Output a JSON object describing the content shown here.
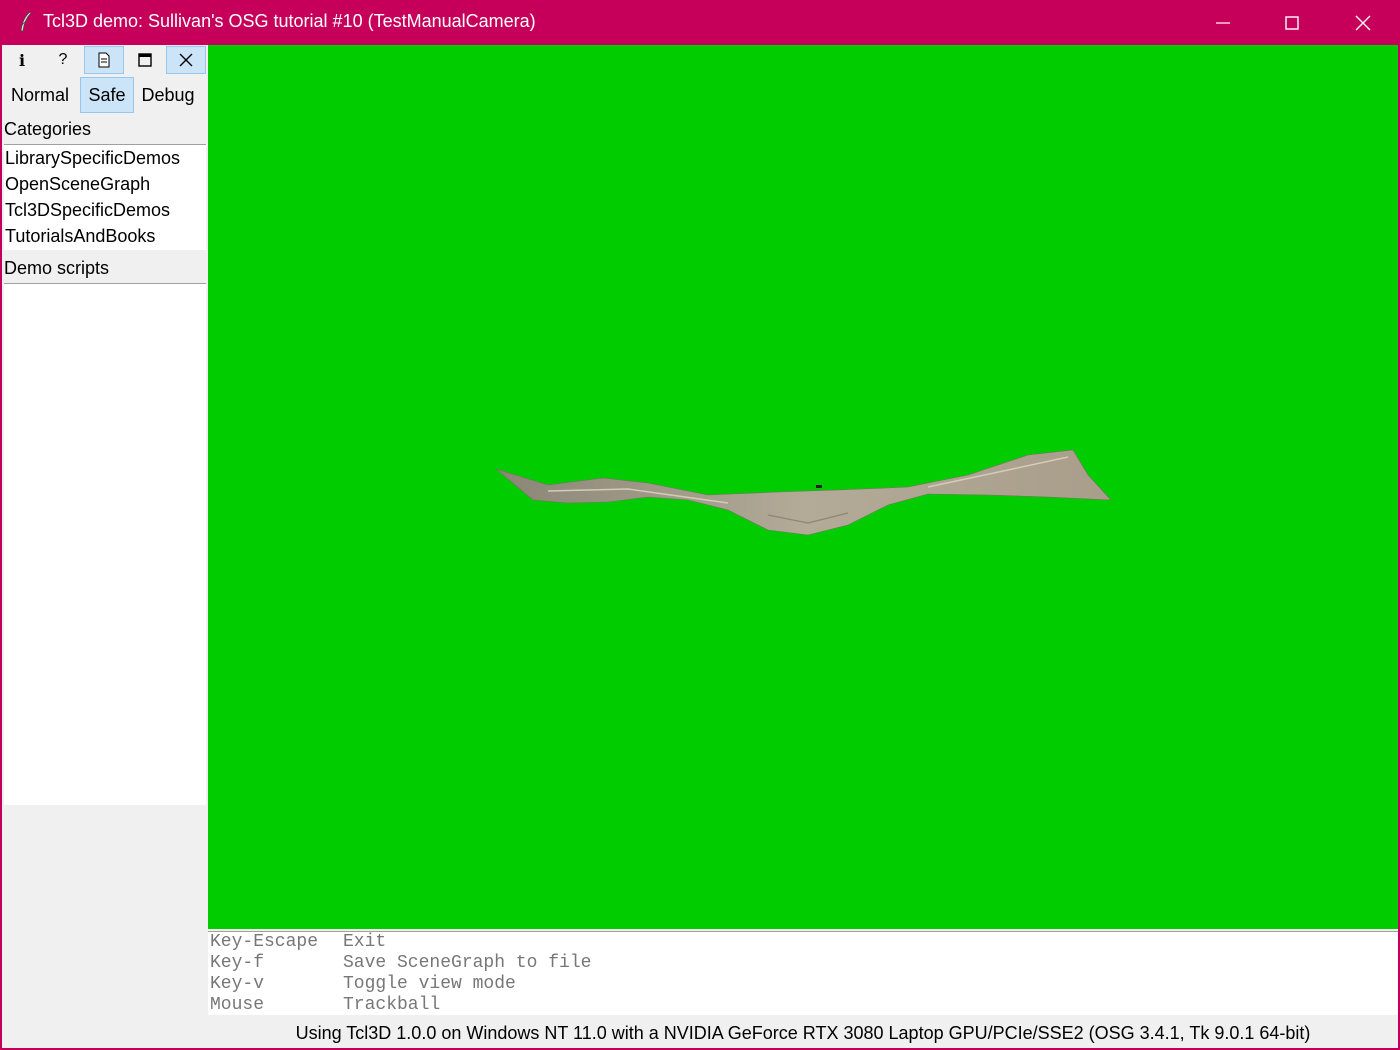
{
  "window": {
    "title": "Tcl3D demo: Sullivan's OSG tutorial #10 (TestManualCamera)",
    "controls": [
      "minimize-icon",
      "maximize-icon",
      "close-icon"
    ],
    "titlebar_color": "#c6005a"
  },
  "toolbar": {
    "icons": [
      "info-icon",
      "help-icon",
      "document-icon",
      "window-icon",
      "close-icon"
    ],
    "pressed": "document-icon"
  },
  "mode": {
    "options": [
      "Normal",
      "Safe",
      "Debug"
    ],
    "selected": "Safe"
  },
  "categories": {
    "label": "Categories",
    "items": [
      "LibrarySpecificDemos",
      "OpenSceneGraph",
      "Tcl3DSpecificDemos",
      "TutorialsAndBooks"
    ]
  },
  "demo_scripts": {
    "label": "Demo scripts",
    "items": []
  },
  "viewport": {
    "background": "#00cc00",
    "content": "textured-terrain"
  },
  "console": {
    "lines": [
      {
        "key": "Key-Escape",
        "action": "Exit"
      },
      {
        "key": "Key-f",
        "action": "Save SceneGraph to file"
      },
      {
        "key": "Key-v",
        "action": "Toggle view mode"
      },
      {
        "key": "Mouse",
        "action": "Trackball"
      }
    ]
  },
  "status": {
    "text": "Using Tcl3D 1.0.0 on Windows NT 11.0 with a NVIDIA GeForce RTX 3080 Laptop GPU/PCIe/SSE2 (OSG 3.4.1, Tk 9.0.1 64-bit)"
  }
}
